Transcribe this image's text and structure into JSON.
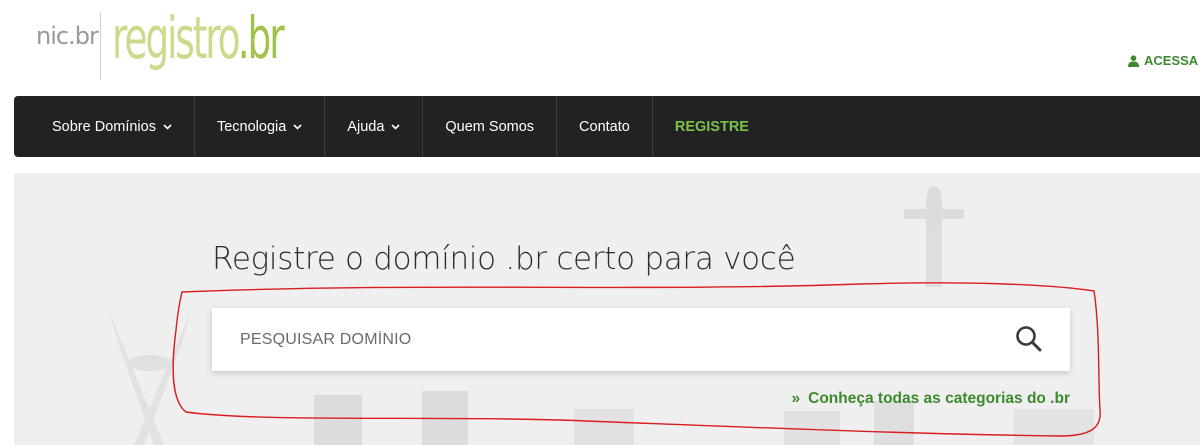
{
  "header": {
    "logo_nic": "nic",
    "logo_nic_suffix": ".br",
    "logo_registro": "registro",
    "logo_registro_suffix": ".br",
    "access_label": "ACESSA"
  },
  "nav": {
    "items": [
      {
        "label": "Sobre Domínios",
        "dropdown": true
      },
      {
        "label": "Tecnologia",
        "dropdown": true
      },
      {
        "label": "Ajuda",
        "dropdown": true
      },
      {
        "label": "Quem Somos",
        "dropdown": false
      },
      {
        "label": "Contato",
        "dropdown": false
      },
      {
        "label": "REGISTRE",
        "dropdown": false
      }
    ]
  },
  "hero": {
    "title": "Registre o domínio .br certo para você",
    "search_placeholder": "PESQUISAR DOMÍNIO",
    "search_icon": "search-icon",
    "categories_prefix": "»",
    "categories_link": "Conheça todas as categorias do .br"
  },
  "colors": {
    "nav_bg": "#222222",
    "register_green": "#7cc14a",
    "link_green": "#3d8a2e",
    "logo_green_light": "#c9dc8b",
    "logo_green": "#a2c34b",
    "hero_bg": "#efefef",
    "annotation_red": "#d81e1e"
  }
}
